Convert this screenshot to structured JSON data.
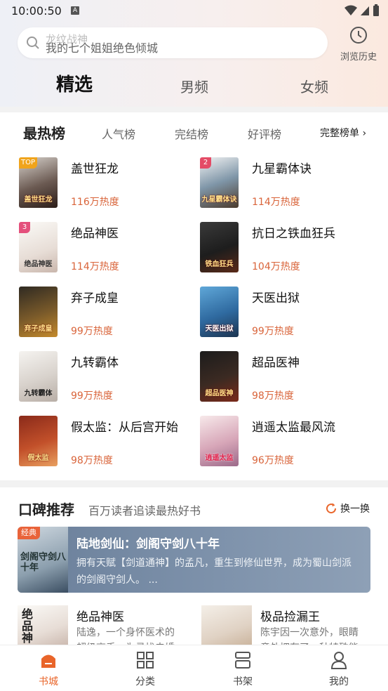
{
  "status_bar": {
    "time": "10:00:50",
    "notif_icon": "A"
  },
  "search": {
    "placeholder_top": "龙纹战神",
    "placeholder": "我的七个姐姐绝色倾城"
  },
  "history": {
    "label": "浏览历史"
  },
  "top_tabs": [
    {
      "label": "精选",
      "active": true
    },
    {
      "label": "男频",
      "active": false
    },
    {
      "label": "女频",
      "active": false
    }
  ],
  "ranking": {
    "heading": "最热榜",
    "tabs": [
      "人气榜",
      "完结榜",
      "好评榜"
    ],
    "full_label": "完整榜单",
    "books": [
      {
        "rank": "TOP",
        "title": "盖世狂龙",
        "heat": "116万热度",
        "cover_text": "盖世狂龙"
      },
      {
        "rank": "2",
        "title": "九星霸体诀",
        "heat": "114万热度",
        "cover_text": "九星霸体诀"
      },
      {
        "rank": "3",
        "title": "绝品神医",
        "heat": "114万热度",
        "cover_text": "绝品神医"
      },
      {
        "rank": "",
        "title": "抗日之铁血狂兵",
        "heat": "104万热度",
        "cover_text": "铁血狂兵"
      },
      {
        "rank": "",
        "title": "弃子成皇",
        "heat": "99万热度",
        "cover_text": "弃子成皇"
      },
      {
        "rank": "",
        "title": "天医出狱",
        "heat": "99万热度",
        "cover_text": "天医出狱"
      },
      {
        "rank": "",
        "title": "九转霸体",
        "heat": "99万热度",
        "cover_text": "九转霸体"
      },
      {
        "rank": "",
        "title": "超品医神",
        "heat": "98万热度",
        "cover_text": "超品医神"
      },
      {
        "rank": "",
        "title": "假太监：从后宫开始",
        "heat": "98万热度",
        "cover_text": "假太监"
      },
      {
        "rank": "",
        "title": "逍遥太监最风流",
        "heat": "96万热度",
        "cover_text": "逍遥太监"
      }
    ]
  },
  "recommend": {
    "heading": "口碑推荐",
    "subtitle": "百万读者追读最热好书",
    "refresh_label": "换一换",
    "featured": {
      "tag": "经典",
      "title": "陆地剑仙：剑阁守剑八十年",
      "description": "拥有天赋【剑道通神】的孟凡，重生到修仙世界，成为蜀山剑派的剑阁守剑人。 ...",
      "cover_text": "剑阁守剑八十年"
    },
    "items": [
      {
        "title": "绝品神医",
        "description": "陆逸，一个身怀医术的超级高手，为寻找未婚",
        "cover_text": "绝品神医"
      },
      {
        "title": "极品捡漏王",
        "description": "陈宇因一次意外，眼睛意外拥有了一种特殊能力",
        "cover_text": ""
      }
    ]
  },
  "bottom_nav": [
    {
      "label": "书城",
      "active": true
    },
    {
      "label": "分类",
      "active": false
    },
    {
      "label": "书架",
      "active": false
    },
    {
      "label": "我的",
      "active": false
    }
  ],
  "colors": {
    "accent": "#e9652a",
    "heat": "#d9643a"
  }
}
